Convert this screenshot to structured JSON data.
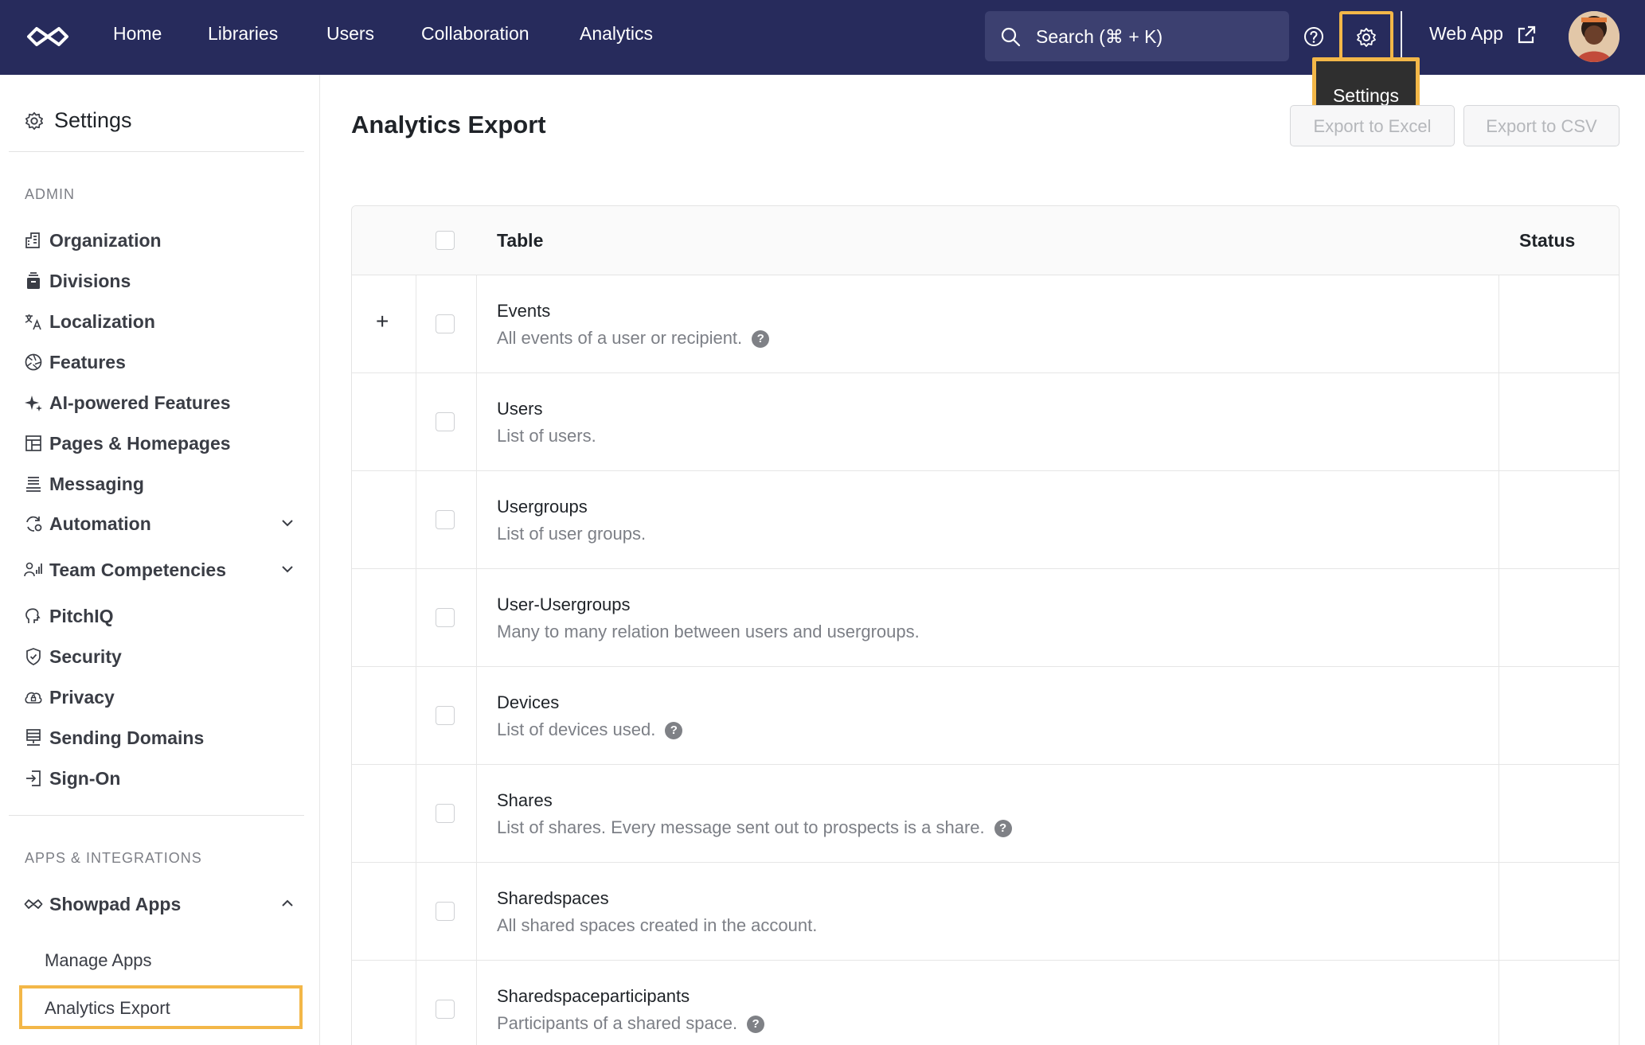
{
  "nav": {
    "items": [
      "Home",
      "Libraries",
      "Users",
      "Collaboration",
      "Analytics"
    ],
    "search_placeholder": "Search (⌘ + K)",
    "webapp_label": "Web App",
    "tooltip": "Settings"
  },
  "sidebar": {
    "title": "Settings",
    "admin_label": "ADMIN",
    "items": [
      {
        "label": "Organization",
        "icon": "building-icon"
      },
      {
        "label": "Divisions",
        "icon": "divisions-icon"
      },
      {
        "label": "Localization",
        "icon": "translate-icon"
      },
      {
        "label": "Features",
        "icon": "aperture-icon"
      },
      {
        "label": "AI-powered Features",
        "icon": "sparkle-icon"
      },
      {
        "label": "Pages & Homepages",
        "icon": "layout-icon"
      },
      {
        "label": "Messaging",
        "icon": "messaging-icon"
      },
      {
        "label": "Automation",
        "icon": "automation-icon"
      },
      {
        "label": "Team Competencies",
        "icon": "competencies-icon"
      },
      {
        "label": "PitchIQ",
        "icon": "pitchiq-icon"
      },
      {
        "label": "Security",
        "icon": "shield-icon"
      },
      {
        "label": "Privacy",
        "icon": "privacy-icon"
      },
      {
        "label": "Sending Domains",
        "icon": "server-icon"
      },
      {
        "label": "Sign-On",
        "icon": "sign-in-icon"
      }
    ],
    "apps_label": "APPS & INTEGRATIONS",
    "apps_group": "Showpad Apps",
    "sub_items": [
      "Manage Apps",
      "Analytics Export"
    ]
  },
  "main": {
    "title": "Analytics Export",
    "export_excel": "Export to Excel",
    "export_csv": "Export to CSV",
    "columns": {
      "table": "Table",
      "status": "Status"
    },
    "rows": [
      {
        "name": "Events",
        "desc": "All events of a user or recipient.",
        "help": true,
        "expandable": true
      },
      {
        "name": "Users",
        "desc": "List of users.",
        "help": false
      },
      {
        "name": "Usergroups",
        "desc": "List of user groups.",
        "help": false
      },
      {
        "name": "User-Usergroups",
        "desc": "Many to many relation between users and usergroups.",
        "help": false
      },
      {
        "name": "Devices",
        "desc": "List of devices used.",
        "help": true
      },
      {
        "name": "Shares",
        "desc": "List of shares. Every message sent out to prospects is a share.",
        "help": true
      },
      {
        "name": "Sharedspaces",
        "desc": "All shared spaces created in the account.",
        "help": false
      },
      {
        "name": "Sharedspaceparticipants",
        "desc": "Participants of a shared space.",
        "help": true
      }
    ],
    "expand_glyph": "+",
    "help_glyph": "?"
  },
  "colors": {
    "topbar": "#272b5c",
    "highlight": "#f3b748"
  }
}
